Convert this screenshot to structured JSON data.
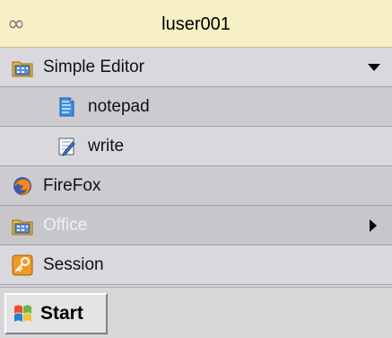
{
  "header": {
    "logo_glyph": "∞",
    "user": "luser001"
  },
  "menu": {
    "items": [
      {
        "label": "Simple Editor",
        "icon": "folder-icon",
        "expanded": true,
        "indicator": "chevron-down-icon"
      },
      {
        "label": "notepad",
        "icon": "notepad-icon"
      },
      {
        "label": "write",
        "icon": "write-icon"
      },
      {
        "label": "FireFox",
        "icon": "firefox-icon"
      },
      {
        "label": "Office",
        "icon": "folder-icon",
        "indicator": "chevron-right-icon"
      },
      {
        "label": "Session",
        "icon": "key-icon"
      }
    ]
  },
  "taskbar": {
    "start_label": "Start"
  },
  "colors": {
    "header_bg": "#f7f0c5",
    "menu_bg": "#d7d6d9",
    "office_label": "#f0f0f0"
  }
}
